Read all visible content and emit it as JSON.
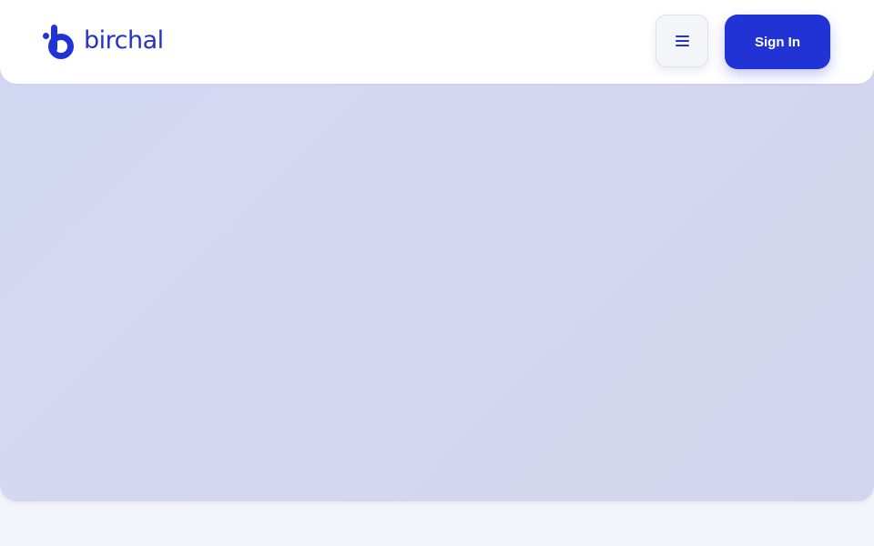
{
  "header": {
    "logo_text": "birchal",
    "brand_color": "#2233d6",
    "menu_icon": "hamburger-icon",
    "sign_in_label": "Sign In"
  },
  "hero": {
    "background_color": "#d3d7f1"
  },
  "footer": {
    "background_color": "#f3f5fa"
  }
}
